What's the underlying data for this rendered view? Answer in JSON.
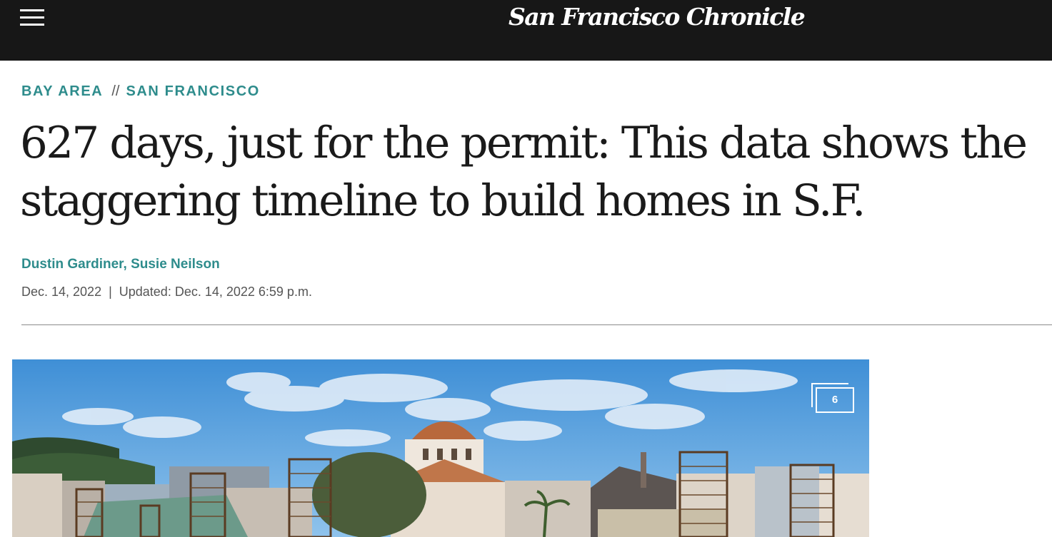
{
  "header": {
    "logo_text": "San Francisco Chronicle",
    "menu_icon": "hamburger-menu-icon"
  },
  "breadcrumb": {
    "section": "BAY AREA",
    "separator": "//",
    "subsection": "SAN FRANCISCO"
  },
  "article": {
    "headline": "627 days, just for the permit: This data shows the staggering timeline to build homes in S.F.",
    "byline": "Dustin Gardiner, Susie Neilson",
    "published": "Dec. 14, 2022",
    "date_separator": "|",
    "updated": "Updated: Dec. 14, 2022 6:59 p.m."
  },
  "hero": {
    "gallery_count": "6",
    "gallery_icon": "photo-gallery-icon"
  },
  "colors": {
    "topbar_bg": "#171717",
    "accent_teal": "#2e8c8c",
    "headline_text": "#1a1a1a",
    "meta_text": "#555555"
  }
}
